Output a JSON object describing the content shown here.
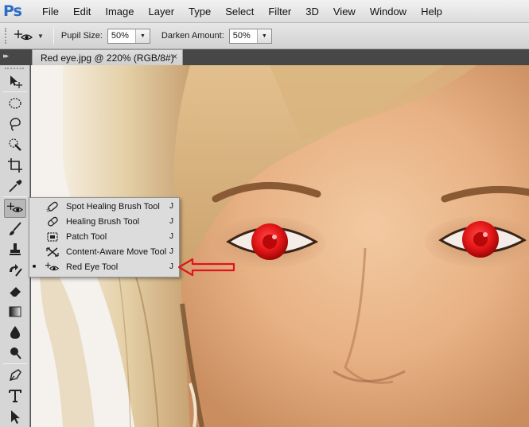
{
  "app": {
    "logo": "Ps"
  },
  "menu": [
    "File",
    "Edit",
    "Image",
    "Layer",
    "Type",
    "Select",
    "Filter",
    "3D",
    "View",
    "Window",
    "Help"
  ],
  "options": {
    "tool_icon": "red-eye-tool-icon",
    "pupil_size_label": "Pupil Size:",
    "pupil_size_value": "50%",
    "darken_amount_label": "Darken Amount:",
    "darken_amount_value": "50%"
  },
  "document": {
    "tab_title": "Red eye.jpg @ 220% (RGB/8#)",
    "close_glyph": "×"
  },
  "flyout": {
    "items": [
      {
        "label": "Spot Healing Brush Tool",
        "key": "J",
        "icon": "spot-healing-brush-icon",
        "selected": false
      },
      {
        "label": "Healing Brush Tool",
        "key": "J",
        "icon": "healing-brush-icon",
        "selected": false
      },
      {
        "label": "Patch Tool",
        "key": "J",
        "icon": "patch-icon",
        "selected": false
      },
      {
        "label": "Content-Aware Move Tool",
        "key": "J",
        "icon": "content-aware-move-icon",
        "selected": false
      },
      {
        "label": "Red Eye Tool",
        "key": "J",
        "icon": "red-eye-icon",
        "selected": true
      }
    ]
  },
  "colors": {
    "annotation": "#e0141b",
    "pupil": "#e31616",
    "brand": "#2d6dc6"
  }
}
